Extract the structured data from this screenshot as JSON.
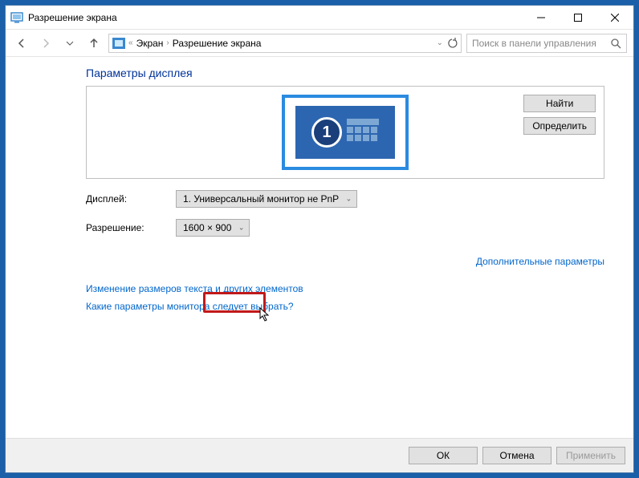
{
  "window": {
    "title": "Разрешение экрана"
  },
  "breadcrumb": {
    "items": [
      "Экран",
      "Разрешение экрана"
    ]
  },
  "search": {
    "placeholder": "Поиск в панели управления"
  },
  "page": {
    "heading": "Параметры дисплея",
    "monitor_number": "1"
  },
  "buttons": {
    "find": "Найти",
    "detect": "Определить",
    "ok": "ОК",
    "cancel": "Отмена",
    "apply": "Применить"
  },
  "form": {
    "display_label": "Дисплей:",
    "display_value": "1. Универсальный монитор не PnP",
    "resolution_label": "Разрешение:",
    "resolution_value": "1600 × 900"
  },
  "links": {
    "advanced": "Дополнительные параметры",
    "text_size": "Изменение размеров текста и других элементов",
    "which_params": "Какие параметры монитора следует выбрать?"
  }
}
